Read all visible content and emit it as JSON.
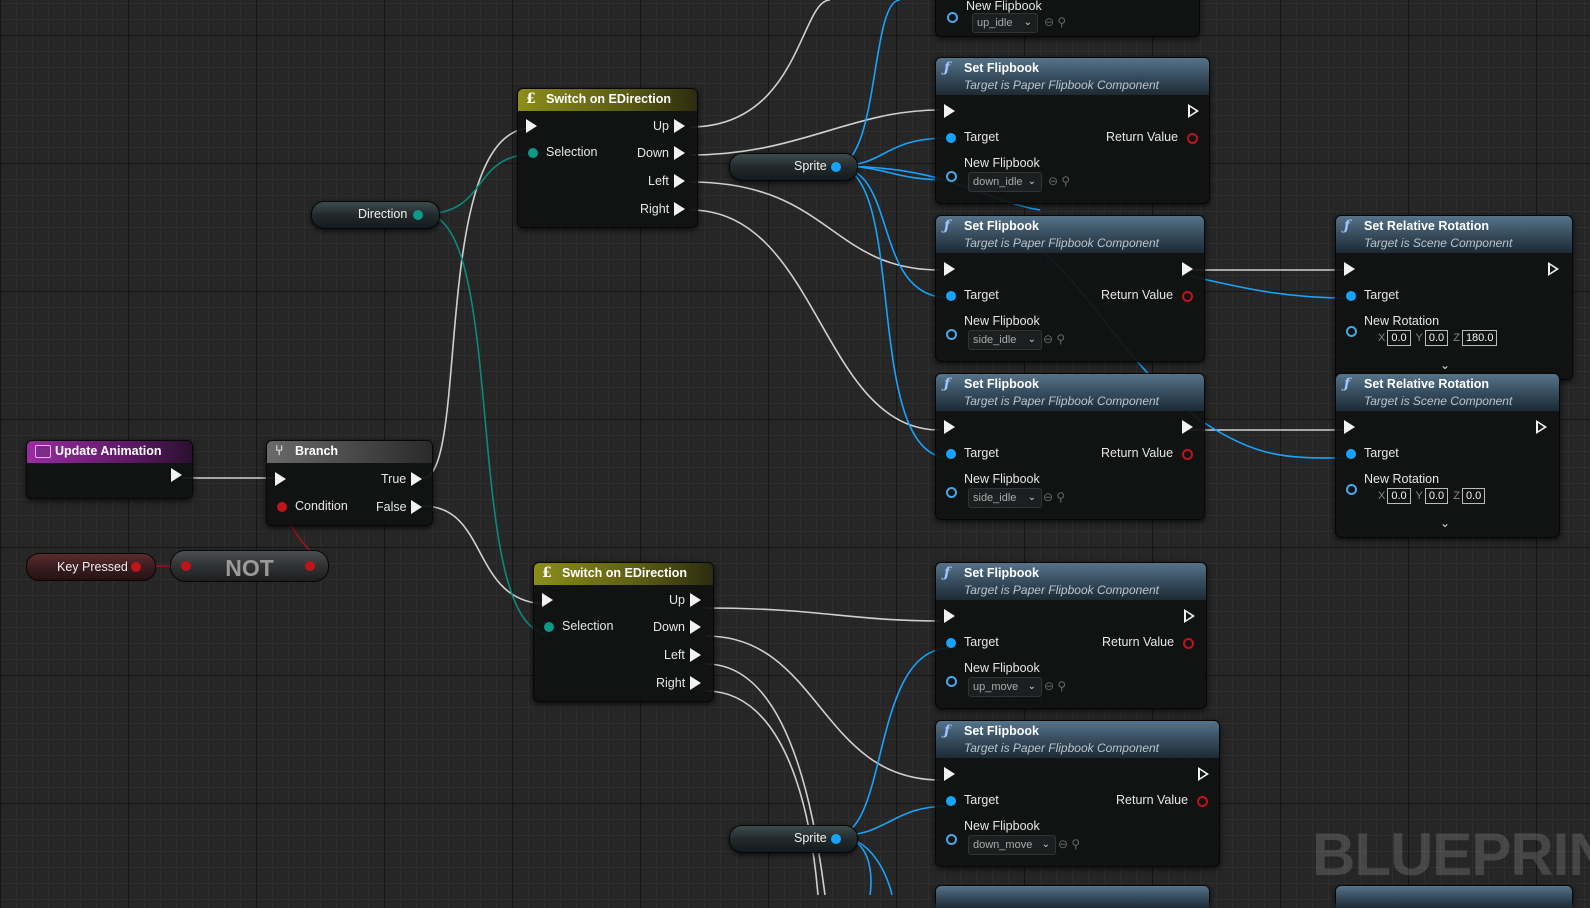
{
  "nodes": {
    "update_animation": {
      "title": "Update Animation"
    },
    "branch": {
      "title": "Branch",
      "true_label": "True",
      "condition_label": "Condition",
      "false_label": "False"
    },
    "key_pressed": {
      "label": "Key Pressed"
    },
    "not": {
      "label": "NOT"
    },
    "direction": {
      "label": "Direction"
    },
    "switch_top": {
      "title": "Switch on EDirection",
      "selection": "Selection",
      "up": "Up",
      "down": "Down",
      "left": "Left",
      "right": "Right"
    },
    "switch_bottom": {
      "title": "Switch on EDirection",
      "selection": "Selection",
      "up": "Up",
      "down": "Down",
      "left": "Left",
      "right": "Right"
    },
    "sprite_top": {
      "label": "Sprite"
    },
    "sprite_bottom": {
      "label": "Sprite"
    },
    "partial_top": {
      "new_flipbook": "New Flipbook",
      "value": "up_idle"
    },
    "set_flipbook_1": {
      "title": "Set Flipbook",
      "subtitle": "Target is Paper Flipbook Component",
      "target": "Target",
      "return": "Return Value",
      "new_flipbook": "New Flipbook",
      "value": "down_idle"
    },
    "set_flipbook_2": {
      "title": "Set Flipbook",
      "subtitle": "Target is Paper Flipbook Component",
      "target": "Target",
      "return": "Return Value",
      "new_flipbook": "New Flipbook",
      "value": "side_idle"
    },
    "set_flipbook_3": {
      "title": "Set Flipbook",
      "subtitle": "Target is Paper Flipbook Component",
      "target": "Target",
      "return": "Return Value",
      "new_flipbook": "New Flipbook",
      "value": "side_idle"
    },
    "set_flipbook_4": {
      "title": "Set Flipbook",
      "subtitle": "Target is Paper Flipbook Component",
      "target": "Target",
      "return": "Return Value",
      "new_flipbook": "New Flipbook",
      "value": "up_move"
    },
    "set_flipbook_5": {
      "title": "Set Flipbook",
      "subtitle": "Target is Paper Flipbook Component",
      "target": "Target",
      "return": "Return Value",
      "new_flipbook": "New Flipbook",
      "value": "down_move"
    },
    "set_rot_1": {
      "title": "Set Relative Rotation",
      "subtitle": "Target is Scene Component",
      "target": "Target",
      "new_rotation": "New Rotation",
      "x_label": "X",
      "y_label": "Y",
      "z_label": "Z",
      "x": "0.0",
      "y": "0.0",
      "z": "180.0"
    },
    "set_rot_2": {
      "title": "Set Relative Rotation",
      "subtitle": "Target is Scene Component",
      "target": "Target",
      "new_rotation": "New Rotation",
      "x_label": "X",
      "y_label": "Y",
      "z_label": "Z",
      "x": "0.0",
      "y": "0.0",
      "z": "0.0"
    }
  },
  "watermark": "BLUEPRIN",
  "colors": {
    "exec_wire": "#d8d8d8",
    "object_wire": "#17a4ff",
    "enum_wire": "#0b8a7a",
    "bool_wire": "#a01018",
    "func_header": "#3b5468",
    "switch_header": "#8c8d1a",
    "event_header": "#9b2ba6"
  }
}
